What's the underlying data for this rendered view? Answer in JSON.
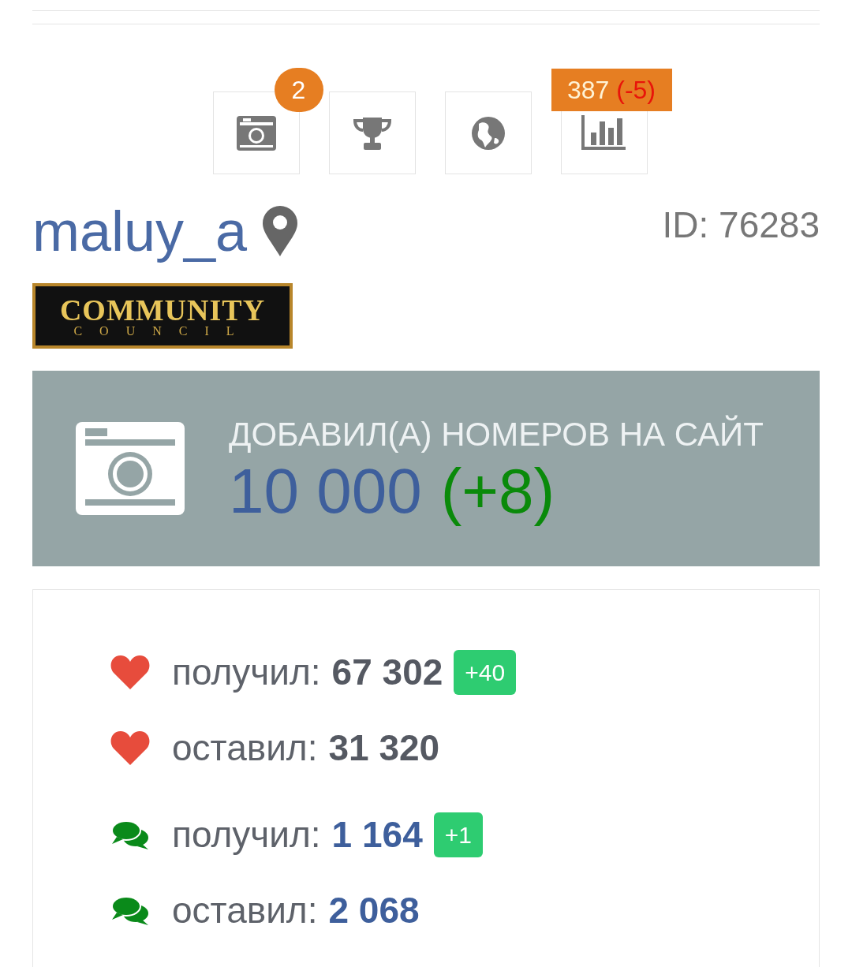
{
  "tiles": [
    {
      "kind": "camera",
      "badge": "2"
    },
    {
      "kind": "trophy"
    },
    {
      "kind": "globe"
    },
    {
      "kind": "chart",
      "count": "387",
      "delta": "(-5)"
    }
  ],
  "profile": {
    "username": "maluy_a",
    "id": "ID: 76283",
    "award": {
      "line1": "COMMUNITY",
      "line2": "COUNCIL"
    }
  },
  "banner": {
    "title": "ДОБАВИЛ(А) НОМЕРОВ НА САЙТ",
    "value": "10 000",
    "delta": "(+8)"
  },
  "stats": [
    {
      "kind": "likes",
      "label": "получил:",
      "value": "67 302",
      "delta": "+40"
    },
    {
      "kind": "likes",
      "label": "оставил:",
      "value": "31 320"
    },
    {
      "kind": "comments",
      "label": "получил:",
      "value": "1 164",
      "delta": "+1"
    },
    {
      "kind": "comments",
      "label": "оставил:",
      "value": "2 068"
    }
  ]
}
